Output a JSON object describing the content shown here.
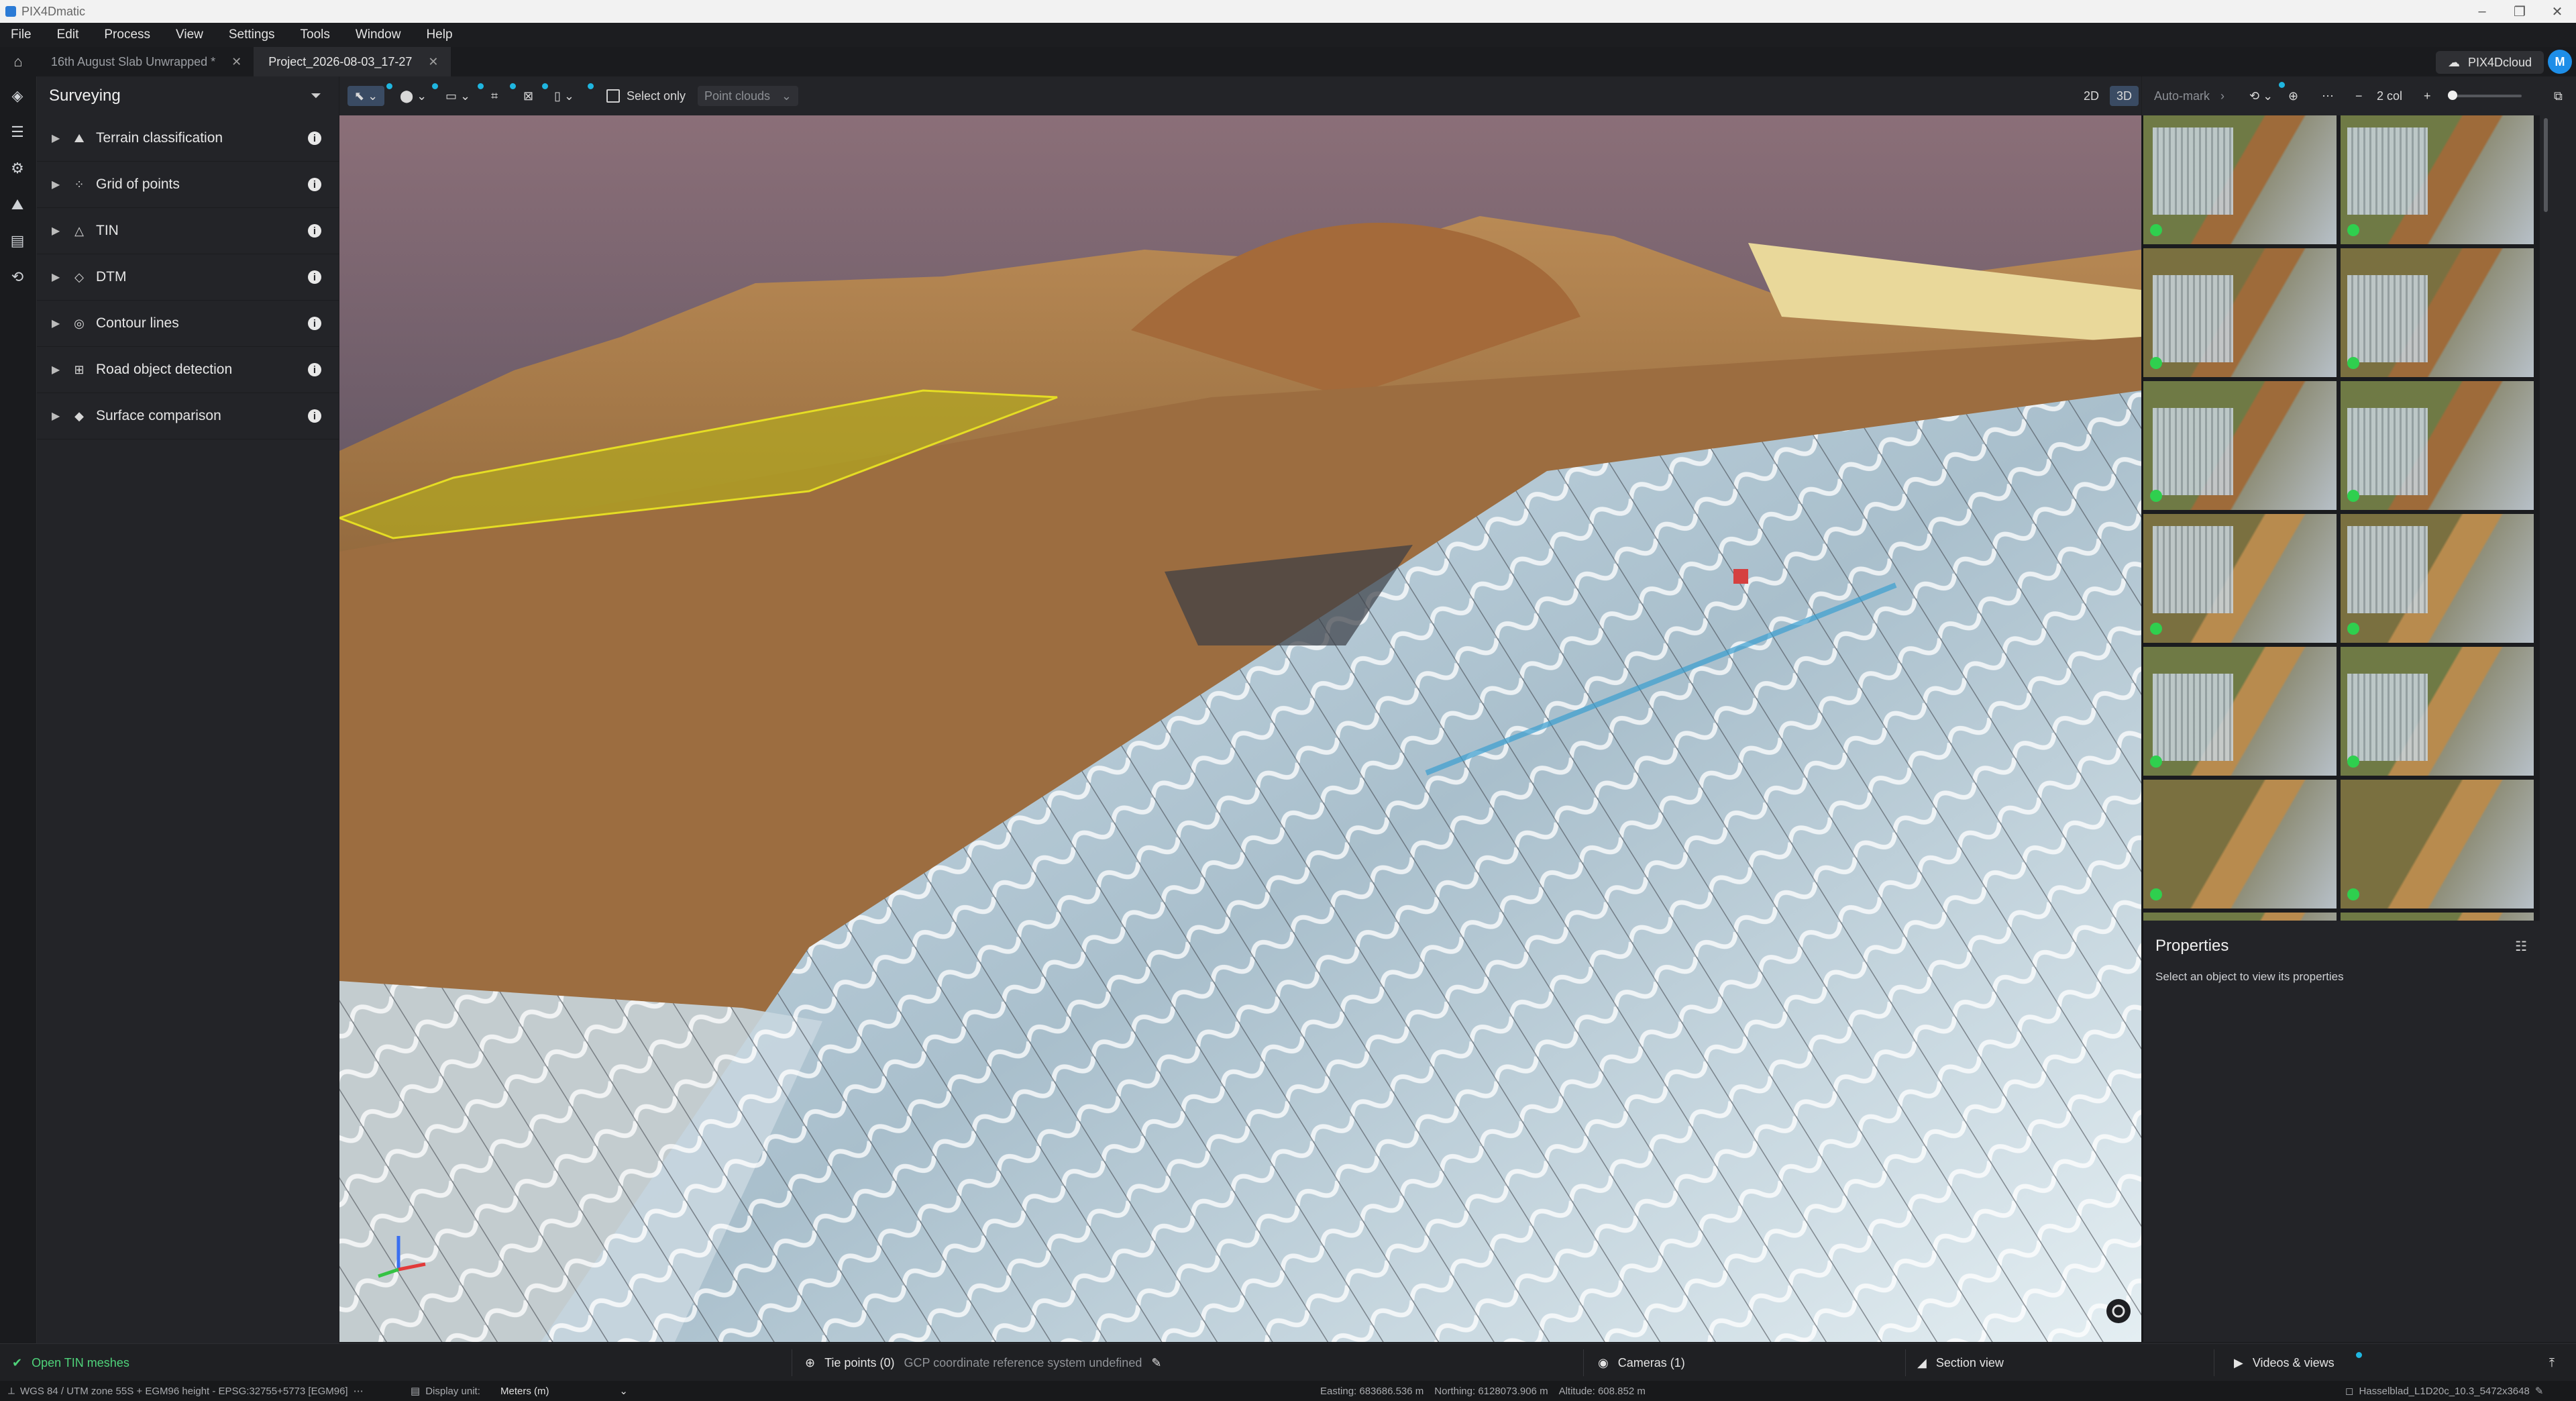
{
  "app": {
    "title": "PIX4Dmatic"
  },
  "menu": [
    "File",
    "Edit",
    "Process",
    "View",
    "Settings",
    "Tools",
    "Window",
    "Help"
  ],
  "tabs": [
    {
      "label": "16th August Slab Unwrapped *",
      "active": false
    },
    {
      "label": "Project_2026-08-03_17-27",
      "active": true
    }
  ],
  "cloud": {
    "label": "PIX4Dcloud",
    "avatar": "M"
  },
  "panel": {
    "title": "Surveying",
    "items": [
      {
        "label": "Terrain classification",
        "icon": "terrain-icon"
      },
      {
        "label": "Grid of points",
        "icon": "grid-icon"
      },
      {
        "label": "TIN",
        "icon": "tin-icon"
      },
      {
        "label": "DTM",
        "icon": "dtm-icon"
      },
      {
        "label": "Contour lines",
        "icon": "contour-icon"
      },
      {
        "label": "Road object detection",
        "icon": "road-icon"
      },
      {
        "label": "Surface comparison",
        "icon": "surface-icon"
      }
    ]
  },
  "toolbar": {
    "select_only": "Select only",
    "point_clouds": "Point clouds",
    "view_2d": "2D",
    "view_3d": "3D",
    "auto_mark": "Auto-mark",
    "columns": "2 col"
  },
  "properties": {
    "title": "Properties",
    "hint": "Select an object to view its properties"
  },
  "status": {
    "left": "Open TIN meshes",
    "tie_points": "Tie points (0)",
    "gcp_note": "GCP coordinate reference system undefined",
    "cameras": "Cameras (1)",
    "section_view": "Section view",
    "videos": "Videos & views"
  },
  "footer": {
    "crs": "WGS 84 / UTM zone 55S + EGM96 height - EPSG:32755+5773 [EGM96]",
    "display_unit_label": "Display unit:",
    "display_unit_value": "Meters (m)",
    "easting": "Easting: 683686.536 m",
    "northing": "Northing: 6128073.906 m",
    "altitude": "Altitude: 608.852 m",
    "camera": "Hasselblad_L1D20c_10.3_5472x3648"
  },
  "colors": {
    "accent": "#1fb6e0",
    "ok": "#2fcf4e",
    "avatar": "#1e8ee8"
  }
}
